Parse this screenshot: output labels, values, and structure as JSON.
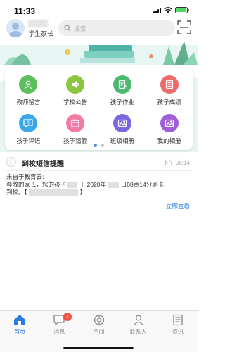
{
  "status_bar": {
    "time": "11:33"
  },
  "header": {
    "user_label": "学生家长",
    "search_placeholder": "搜索"
  },
  "banner": {
    "active_page": 1,
    "page_count": 2
  },
  "grid": {
    "items": [
      {
        "label": "教师留言",
        "color": "#5cbf5c",
        "icon": "teacher-message-icon"
      },
      {
        "label": "学校公告",
        "color": "#8cc63f",
        "icon": "school-announcement-icon"
      },
      {
        "label": "孩子作业",
        "color": "#4cb96f",
        "icon": "homework-icon"
      },
      {
        "label": "孩子成绩",
        "color": "#f06a6a",
        "icon": "grades-icon"
      },
      {
        "label": "孩子评语",
        "color": "#3aa7e8",
        "icon": "comment-icon"
      },
      {
        "label": "孩子请假",
        "color": "#f07ca7",
        "icon": "leave-icon"
      },
      {
        "label": "班级相册",
        "color": "#7d67e0",
        "icon": "class-album-icon"
      },
      {
        "label": "我的相册",
        "color": "#a05ed8",
        "icon": "my-album-icon"
      }
    ]
  },
  "message": {
    "title": "到校短信提醒",
    "time": "上午 08:14",
    "line1": "来自于教育云:",
    "line2_a": "尊敬的家长，您的孩子",
    "line2_b": "于 2020年",
    "line2_c": "日08点14分刷卡",
    "line3_a": "到校。【",
    "line3_b": "】",
    "view_label": "立即查看"
  },
  "tabbar": {
    "tabs": [
      {
        "label": "首页",
        "icon": "home-icon",
        "active": true
      },
      {
        "label": "消息",
        "icon": "message-icon",
        "badge": "1"
      },
      {
        "label": "空间",
        "icon": "space-icon"
      },
      {
        "label": "联系人",
        "icon": "contacts-icon"
      },
      {
        "label": "资讯",
        "icon": "news-icon"
      }
    ]
  },
  "colors": {
    "accent": "#2c7be5",
    "badge": "#f0554c"
  }
}
